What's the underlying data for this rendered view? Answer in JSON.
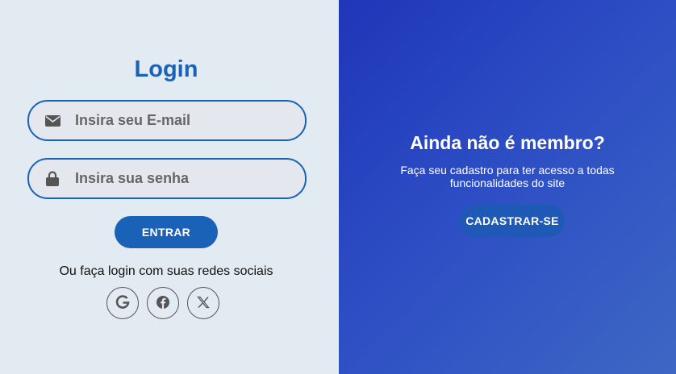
{
  "login": {
    "title": "Login",
    "email_placeholder": "Insira seu E-mail",
    "password_placeholder": "Insira sua senha",
    "submit_label": "ENTRAR",
    "social_text": "Ou faça login com suas redes sociais",
    "social_icons": [
      "google-icon",
      "facebook-icon",
      "x-icon"
    ]
  },
  "signup": {
    "title": "Ainda não é membro?",
    "text": "Faça seu cadastro para ter acesso a todas funcionalidades do site",
    "button_label": "CADASTRAR-SE"
  },
  "colors": {
    "accent": "#1a62b7",
    "left_bg": "#e1ebf1",
    "right_bg_start": "#1f36b8",
    "right_bg_end": "#3e67c4"
  }
}
